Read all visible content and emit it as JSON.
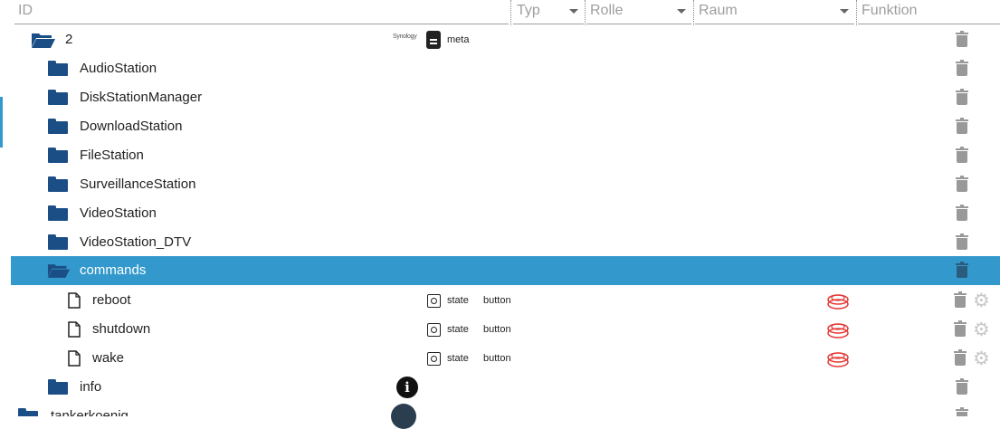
{
  "header": {
    "id_placeholder": "ID",
    "typ_placeholder": "Typ",
    "rolle_placeholder": "Rolle",
    "raum_placeholder": "Raum",
    "funktion_placeholder": "Funktion"
  },
  "rows": [
    {
      "label": "2",
      "open": true,
      "brand": "Synology",
      "meta_label": "meta"
    },
    {
      "label": "AudioStation"
    },
    {
      "label": "DiskStationManager"
    },
    {
      "label": "DownloadStation"
    },
    {
      "label": "FileStation"
    },
    {
      "label": "SurveillanceStation"
    },
    {
      "label": "VideoStation"
    },
    {
      "label": "VideoStation_DTV"
    },
    {
      "label": "commands",
      "open": true,
      "selected": true
    },
    {
      "label": "reboot",
      "type": "state",
      "role": "button"
    },
    {
      "label": "shutdown",
      "type": "state",
      "role": "button"
    },
    {
      "label": "wake",
      "type": "state",
      "role": "button"
    },
    {
      "label": "info"
    },
    {
      "label": "tankerkoenig"
    }
  ],
  "colors": {
    "accent": "#3399cc",
    "folder": "#1b4e85",
    "button_red": "#e53935",
    "trash": "#999999"
  },
  "icons": [
    "folder-icon",
    "folder-open-icon",
    "file-icon",
    "trash-icon",
    "gear-icon",
    "state-icon",
    "button-icon",
    "info-icon",
    "document-icon"
  ]
}
